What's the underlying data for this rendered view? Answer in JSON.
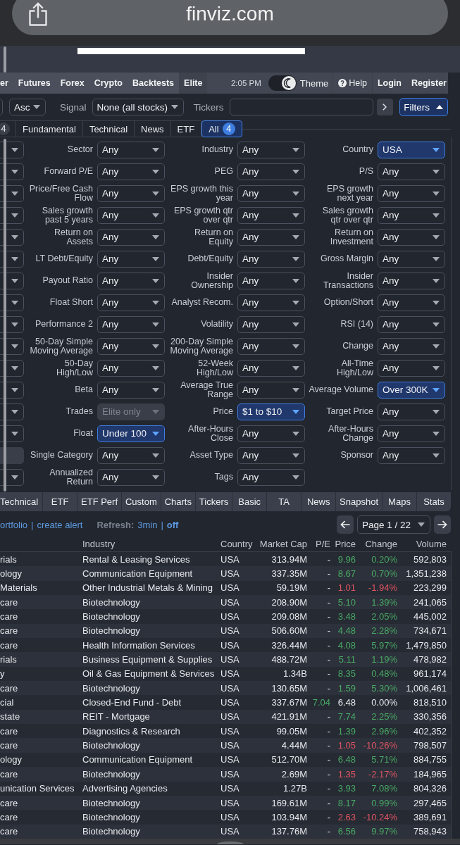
{
  "browser": {
    "url": "finviz.com"
  },
  "nav": {
    "items": [
      {
        "label": "er",
        "selected": false
      },
      {
        "label": "Futures",
        "selected": false
      },
      {
        "label": "Forex",
        "selected": false
      },
      {
        "label": "Crypto",
        "selected": false
      },
      {
        "label": "Backtests",
        "selected": false
      },
      {
        "label": "Elite",
        "selected": true
      }
    ],
    "time": "2:05 PM",
    "theme": {
      "label": "Theme",
      "on": true
    },
    "links": [
      {
        "label": "Help",
        "kind": "help"
      },
      {
        "label": "Login",
        "kind": "account"
      },
      {
        "label": "Register",
        "kind": "account"
      }
    ]
  },
  "controls": {
    "order": {
      "value": "Asc"
    },
    "signal": {
      "label": "Signal",
      "value": "None (all stocks)"
    },
    "tickers": {
      "label": "Tickers"
    },
    "filters_button": {
      "label": "Filters",
      "expanded": true
    }
  },
  "filter_tabs": [
    {
      "badge": "4",
      "selected": false
    },
    {
      "label": "Fundamental",
      "selected": false
    },
    {
      "label": "Technical",
      "selected": false
    },
    {
      "label": "News",
      "selected": false
    },
    {
      "label": "ETF",
      "selected": false
    },
    {
      "label": "All",
      "badge": "4",
      "selected": true
    }
  ],
  "filters": [
    {
      "edge_select": {
        "disabled": false
      },
      "cells": [
        {
          "label": "Sector",
          "value": "Any",
          "active": false,
          "disabled": false
        },
        {
          "label": "Industry",
          "value": "Any",
          "active": false,
          "disabled": false
        },
        {
          "label": "Country",
          "value": "USA",
          "active": true,
          "disabled": false
        }
      ]
    },
    {
      "edge_select": {
        "disabled": false
      },
      "cells": [
        {
          "label": "Forward P/E",
          "value": "Any",
          "active": false,
          "disabled": false
        },
        {
          "label": "PEG",
          "value": "Any",
          "active": false,
          "disabled": false
        },
        {
          "label": "P/S",
          "value": "Any",
          "active": false,
          "disabled": false
        }
      ]
    },
    {
      "edge_select": {
        "disabled": false
      },
      "cells": [
        {
          "label": "Price/Free Cash Flow",
          "value": "Any",
          "active": false,
          "disabled": false
        },
        {
          "label": "EPS growth this year",
          "value": "Any",
          "active": false,
          "disabled": false
        },
        {
          "label": "EPS growth next year",
          "value": "Any",
          "active": false,
          "disabled": false
        }
      ]
    },
    {
      "edge_select": {
        "disabled": false
      },
      "cells": [
        {
          "label": "Sales growth past 5 years",
          "value": "Any",
          "active": false,
          "disabled": false
        },
        {
          "label": "EPS growth qtr over qtr",
          "value": "Any",
          "active": false,
          "disabled": false
        },
        {
          "label": "Sales growth qtr over qtr",
          "value": "Any",
          "active": false,
          "disabled": false
        }
      ]
    },
    {
      "edge_select": {
        "disabled": false
      },
      "cells": [
        {
          "label": "Return on Assets",
          "value": "Any",
          "active": false,
          "disabled": false
        },
        {
          "label": "Return on Equity",
          "value": "Any",
          "active": false,
          "disabled": false
        },
        {
          "label": "Return on Investment",
          "value": "Any",
          "active": false,
          "disabled": false
        }
      ]
    },
    {
      "edge_select": {
        "disabled": false
      },
      "cells": [
        {
          "label": "LT Debt/Equity",
          "value": "Any",
          "active": false,
          "disabled": false
        },
        {
          "label": "Debt/Equity",
          "value": "Any",
          "active": false,
          "disabled": false
        },
        {
          "label": "Gross Margin",
          "value": "Any",
          "active": false,
          "disabled": false
        }
      ]
    },
    {
      "edge_select": {
        "disabled": false
      },
      "cells": [
        {
          "label": "Payout Ratio",
          "value": "Any",
          "active": false,
          "disabled": false
        },
        {
          "label": "Insider Ownership",
          "value": "Any",
          "active": false,
          "disabled": false
        },
        {
          "label": "Insider Transactions",
          "value": "Any",
          "active": false,
          "disabled": false
        }
      ]
    },
    {
      "edge_select": {
        "disabled": false
      },
      "cells": [
        {
          "label": "Float Short",
          "value": "Any",
          "active": false,
          "disabled": false
        },
        {
          "label": "Analyst Recom.",
          "value": "Any",
          "active": false,
          "disabled": false
        },
        {
          "label": "Option/Short",
          "value": "Any",
          "active": false,
          "disabled": false
        }
      ]
    },
    {
      "edge_select": {
        "disabled": false
      },
      "cells": [
        {
          "label": "Performance 2",
          "value": "Any",
          "active": false,
          "disabled": false
        },
        {
          "label": "Volatility",
          "value": "Any",
          "active": false,
          "disabled": false
        },
        {
          "label": "RSI (14)",
          "value": "Any",
          "active": false,
          "disabled": false
        }
      ]
    },
    {
      "edge_select": {
        "disabled": false
      },
      "cells": [
        {
          "label": "50-Day Simple Moving Average",
          "value": "Any",
          "active": false,
          "disabled": false
        },
        {
          "label": "200-Day Simple Moving Average",
          "value": "Any",
          "active": false,
          "disabled": false
        },
        {
          "label": "Change",
          "value": "Any",
          "active": false,
          "disabled": false
        }
      ]
    },
    {
      "edge_select": {
        "disabled": false
      },
      "cells": [
        {
          "label": "50-Day High/Low",
          "value": "Any",
          "active": false,
          "disabled": false
        },
        {
          "label": "52-Week High/Low",
          "value": "Any",
          "active": false,
          "disabled": false
        },
        {
          "label": "All-Time High/Low",
          "value": "Any",
          "active": false,
          "disabled": false
        }
      ]
    },
    {
      "edge_select": {
        "disabled": false
      },
      "cells": [
        {
          "label": "Beta",
          "value": "Any",
          "active": false,
          "disabled": false
        },
        {
          "label": "Average True Range",
          "value": "Any",
          "active": false,
          "disabled": false
        },
        {
          "label": "Average Volume",
          "value": "Over 300K",
          "active": true,
          "disabled": false
        }
      ]
    },
    {
      "edge_select": {
        "disabled": false
      },
      "cells": [
        {
          "label": "Trades",
          "value": "Elite only",
          "active": false,
          "disabled": true
        },
        {
          "label": "Price",
          "value": "$1 to $10",
          "active": true,
          "disabled": false
        },
        {
          "label": "Target Price",
          "value": "Any",
          "active": false,
          "disabled": false
        }
      ]
    },
    {
      "edge_select": {
        "disabled": false
      },
      "cells": [
        {
          "label": "Float",
          "value": "Under 100",
          "active": true,
          "disabled": false
        },
        {
          "label": "After-Hours Close",
          "value": "Any",
          "active": false,
          "disabled": false
        },
        {
          "label": "After-Hours Change",
          "value": "Any",
          "active": false,
          "disabled": false
        }
      ]
    },
    {
      "edge_select": {
        "disabled": true
      },
      "cells": [
        {
          "label": "Single Category",
          "value": "Any",
          "active": false,
          "disabled": false
        },
        {
          "label": "Asset Type",
          "value": "Any",
          "active": false,
          "disabled": false
        },
        {
          "label": "Sponsor",
          "value": "Any",
          "active": false,
          "disabled": false
        }
      ]
    },
    {
      "edge_select": {
        "disabled": false
      },
      "cells": [
        {
          "label": "Annualized Return",
          "value": "Any",
          "active": false,
          "disabled": false
        },
        {
          "label": "Tags",
          "value": "Any",
          "active": false,
          "disabled": false
        }
      ]
    }
  ],
  "view_tabs": [
    {
      "label": "Technical",
      "selected": false
    },
    {
      "label": "ETF",
      "selected": false
    },
    {
      "label": "ETF Perf",
      "selected": false
    },
    {
      "label": "Custom",
      "selected": false
    },
    {
      "label": "Charts",
      "selected": false
    },
    {
      "label": "Tickers",
      "selected": false
    },
    {
      "label": "Basic",
      "selected": false
    },
    {
      "label": "TA",
      "selected": false
    },
    {
      "label": "News",
      "selected": false
    },
    {
      "label": "Snapshot",
      "selected": false
    },
    {
      "label": "Maps",
      "selected": false
    },
    {
      "label": "Stats",
      "selected": false
    }
  ],
  "actions": {
    "links": [
      {
        "label": "ortfolio"
      },
      {
        "label": "create alert"
      }
    ],
    "separator": "|",
    "refresh": {
      "label": "Refresh:",
      "separator": "|",
      "options": [
        {
          "label": "3min",
          "selected": false
        },
        {
          "label": "off",
          "selected": true
        }
      ]
    },
    "pager": {
      "value": "Page 1 / 22"
    }
  },
  "table": {
    "columns": [
      "Industry",
      "Country",
      "Market Cap",
      "P/E",
      "Price",
      "Change",
      "Volume"
    ],
    "rows": [
      {
        "column_1": "rials",
        "industry": "Rental & Leasing Services",
        "country": "USA",
        "market_cap": "313.94M",
        "pe": {
          "value": "-"
        },
        "price": "9.96",
        "change": "0.20%",
        "color": "#48a964",
        "volume": "592,803"
      },
      {
        "column_1": "ology",
        "industry": "Communication Equipment",
        "country": "USA",
        "market_cap": "337.35M",
        "pe": {
          "value": "-"
        },
        "price": "8.67",
        "change": "0.70%",
        "color": "#48a964",
        "volume": "1,351,238"
      },
      {
        "column_1": "Materials",
        "industry": "Other Industrial Metals & Mining",
        "country": "USA",
        "market_cap": "59.19M",
        "pe": {
          "value": "-"
        },
        "price": "1.01",
        "change": "-1.94%",
        "color": "#de5461",
        "volume": "223,299"
      },
      {
        "column_1": "care",
        "industry": "Biotechnology",
        "country": "USA",
        "market_cap": "208.90M",
        "pe": {
          "value": "-"
        },
        "price": "5.10",
        "change": "1.39%",
        "color": "#48a964",
        "volume": "241,065"
      },
      {
        "column_1": "care",
        "industry": "Biotechnology",
        "country": "USA",
        "market_cap": "209.08M",
        "pe": {
          "value": "-"
        },
        "price": "3.48",
        "change": "2.05%",
        "color": "#48a964",
        "volume": "445,002"
      },
      {
        "column_1": "care",
        "industry": "Biotechnology",
        "country": "USA",
        "market_cap": "506.60M",
        "pe": {
          "value": "-"
        },
        "price": "4.48",
        "change": "2.28%",
        "color": "#48a964",
        "volume": "734,671"
      },
      {
        "column_1": "care",
        "industry": "Health Information Services",
        "country": "USA",
        "market_cap": "326.44M",
        "pe": {
          "value": "-"
        },
        "price": "4.08",
        "change": "5.97%",
        "color": "#48a964",
        "volume": "1,479,850"
      },
      {
        "column_1": "rials",
        "industry": "Business Equipment & Supplies",
        "country": "USA",
        "market_cap": "488.72M",
        "pe": {
          "value": "-"
        },
        "price": "5.11",
        "change": "1.19%",
        "color": "#48a964",
        "volume": "478,982"
      },
      {
        "column_1": "y",
        "industry": "Oil & Gas Equipment & Services",
        "country": "USA",
        "market_cap": "1.34B",
        "pe": {
          "value": "-"
        },
        "price": "8.35",
        "change": "0.48%",
        "color": "#48a964",
        "volume": "961,174"
      },
      {
        "column_1": "care",
        "industry": "Biotechnology",
        "country": "USA",
        "market_cap": "130.65M",
        "pe": {
          "value": "-"
        },
        "price": "1.59",
        "change": "5.30%",
        "color": "#48a964",
        "volume": "1,006,461"
      },
      {
        "column_1": "cial",
        "industry": "Closed-End Fund - Debt",
        "country": "USA",
        "market_cap": "337.67M",
        "pe": {
          "value": "7.04",
          "color": "#48a964"
        },
        "price": "6.48",
        "change": "0.00%",
        "color": "#e6e8ec",
        "volume": "818,510"
      },
      {
        "column_1": "state",
        "industry": "REIT - Mortgage",
        "country": "USA",
        "market_cap": "421.91M",
        "pe": {
          "value": "-"
        },
        "price": "7.74",
        "change": "2.25%",
        "color": "#48a964",
        "volume": "330,356"
      },
      {
        "column_1": "care",
        "industry": "Diagnostics & Research",
        "country": "USA",
        "market_cap": "99.05M",
        "pe": {
          "value": "-"
        },
        "price": "1.39",
        "change": "2.96%",
        "color": "#48a964",
        "volume": "402,352"
      },
      {
        "column_1": "care",
        "industry": "Biotechnology",
        "country": "USA",
        "market_cap": "4.44M",
        "pe": {
          "value": "-"
        },
        "price": "1.05",
        "change": "-10.26%",
        "color": "#de5461",
        "volume": "798,507"
      },
      {
        "column_1": "ology",
        "industry": "Communication Equipment",
        "country": "USA",
        "market_cap": "512.70M",
        "pe": {
          "value": "-"
        },
        "price": "6.48",
        "change": "5.71%",
        "color": "#48a964",
        "volume": "884,755"
      },
      {
        "column_1": "care",
        "industry": "Biotechnology",
        "country": "USA",
        "market_cap": "2.69M",
        "pe": {
          "value": "-"
        },
        "price": "1.35",
        "change": "-2.17%",
        "color": "#de5461",
        "volume": "184,965"
      },
      {
        "column_1": "unication Services",
        "industry": "Advertising Agencies",
        "country": "USA",
        "market_cap": "1.27B",
        "pe": {
          "value": "-"
        },
        "price": "3.93",
        "change": "7.08%",
        "color": "#48a964",
        "volume": "804,326"
      },
      {
        "column_1": "care",
        "industry": "Biotechnology",
        "country": "USA",
        "market_cap": "169.61M",
        "pe": {
          "value": "-"
        },
        "price": "8.17",
        "change": "0.99%",
        "color": "#48a964",
        "volume": "297,465"
      },
      {
        "column_1": "care",
        "industry": "Biotechnology",
        "country": "USA",
        "market_cap": "103.94M",
        "pe": {
          "value": "-"
        },
        "price": "2.63",
        "change": "-10.24%",
        "color": "#de5461",
        "volume": "389,691"
      },
      {
        "column_1": "care",
        "industry": "Biotechnology",
        "country": "USA",
        "market_cap": "137.76M",
        "pe": {
          "value": "-"
        },
        "price": "6.56",
        "change": "9.97%",
        "color": "#48a964",
        "volume": "758,943"
      }
    ]
  }
}
